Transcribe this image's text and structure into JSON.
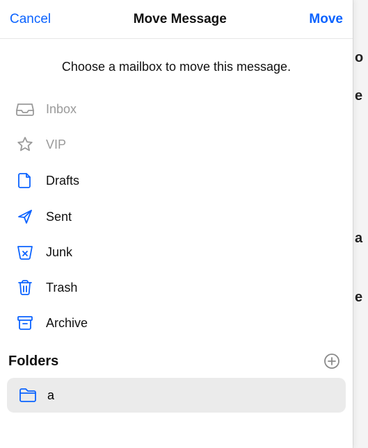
{
  "navbar": {
    "cancel": "Cancel",
    "title": "Move Message",
    "move": "Move"
  },
  "prompt": "Choose a mailbox to move this message.",
  "mailboxes": [
    {
      "id": "inbox",
      "label": "Inbox",
      "icon": "inbox-icon",
      "enabled": false,
      "iconColor": "#9a9a9a"
    },
    {
      "id": "vip",
      "label": "VIP",
      "icon": "star-icon",
      "enabled": false,
      "iconColor": "#9a9a9a"
    },
    {
      "id": "drafts",
      "label": "Drafts",
      "icon": "file-icon",
      "enabled": true,
      "iconColor": "#0b63ff"
    },
    {
      "id": "sent",
      "label": "Sent",
      "icon": "send-icon",
      "enabled": true,
      "iconColor": "#0b63ff"
    },
    {
      "id": "junk",
      "label": "Junk",
      "icon": "junk-icon",
      "enabled": true,
      "iconColor": "#0b63ff"
    },
    {
      "id": "trash",
      "label": "Trash",
      "icon": "trash-icon",
      "enabled": true,
      "iconColor": "#0b63ff"
    },
    {
      "id": "archive",
      "label": "Archive",
      "icon": "archive-icon",
      "enabled": true,
      "iconColor": "#0b63ff"
    }
  ],
  "foldersSection": {
    "title": "Folders"
  },
  "folders": [
    {
      "id": "a",
      "label": "a",
      "icon": "folder-icon",
      "iconColor": "#0b63ff"
    }
  ],
  "backdrop": {
    "frag1": "o",
    "frag2": "e",
    "frag3": "a",
    "frag4": "e"
  }
}
